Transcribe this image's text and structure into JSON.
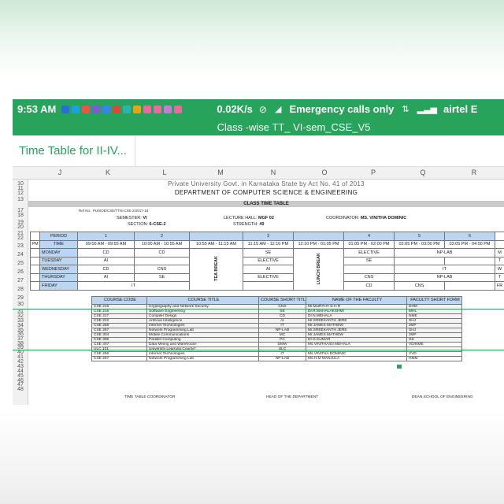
{
  "status_bar": {
    "time": "9:53 AM",
    "net_speed": "0.02K/s",
    "emergency": "Emergency calls only",
    "carrier": "airtel E",
    "notification_icon_colors": [
      "#2a6cd6",
      "#1aa1e0",
      "#e8534a",
      "#7c5bd6",
      "#3a82f0",
      "#d64a3e",
      "#2bb5a6",
      "#e5a31a",
      "#e86aa0",
      "#e86aa0",
      "#c77bd8",
      "#e86aa0"
    ]
  },
  "title_bar": {
    "title": "Class -wise TT_ VI-sem_CSE_V5"
  },
  "sheet_tab": {
    "label": "Time Table for II-IV..."
  },
  "columns": [
    "J",
    "K",
    "L",
    "M",
    "N",
    "O",
    "P",
    "Q",
    "R"
  ],
  "rows": [
    "10",
    "11",
    "12",
    "13",
    "17",
    "18",
    "19",
    "20",
    "21",
    "22",
    "23",
    "24",
    "25",
    "26",
    "27",
    "28",
    "29",
    "30",
    "31",
    "32",
    "33",
    "34",
    "35",
    "36",
    "37",
    "38",
    "39",
    "40",
    "41",
    "42",
    "43",
    "44",
    "45",
    "46",
    "47",
    "48"
  ],
  "header": {
    "tiny_note": "Private University Govt. in Karnataka State by Act No. 41 of 2013",
    "department": "DEPARTMENT  OF  COMPUTER  SCIENCE  &  ENGINEERING",
    "class_time_table": "CLASS TIME TABLE",
    "ref_no": "Ref No.: PU/SOE/CSE/TT/6-CSE-2/2017-18",
    "semester_label": "SEMESTER:",
    "semester": "VI",
    "section_label": "SECTION:",
    "section": "6-CSE-2",
    "hall_label": "LECTURE HALL:",
    "hall": "MGF 02",
    "strength_label": "STRENGTH:",
    "strength": "49",
    "coordinator_label": "COORDINATOR:",
    "coordinator": "MS. VINITHA DOMINIC"
  },
  "timetable": {
    "period_label": "PERIOD",
    "time_label": "TIME",
    "left_cut": [
      "PM"
    ],
    "periods": [
      "1",
      "2",
      "",
      "3",
      "",
      "4",
      "5",
      "6"
    ],
    "times": [
      "09:00 AM - 09:55 AM",
      "10:00 AM - 10:55 AM",
      "10:55 AM - 11:15 AM",
      "11:15 AM - 12:10 PM",
      "12:10 PM - 01:05 PM",
      "01:05 PM - 02:00 PM",
      "02:05 PM - 03:00 PM",
      "03:05 PM - 04:00 PM"
    ],
    "tea_break": "TEA BREAK",
    "lunch_break": "LUNCH BREAK",
    "days": [
      "MONDAY",
      "TUESDAY",
      "WEDNESDAY",
      "THURSDAY",
      "FRIDAY"
    ],
    "right_cut": [
      "M",
      "T",
      "W",
      "T",
      "FR"
    ],
    "monday": {
      "p1": "CD",
      "p2": "CD",
      "p3": "SE",
      "p4": "ELECTIVE",
      "p56": "NP-LAB"
    },
    "tuesday": {
      "p1": "AI",
      "p3": "ELECTIVE",
      "p4": "SE"
    },
    "wednesday": {
      "p1": "CD",
      "p2": "CNS",
      "p3": "AI",
      "p56": "IT"
    },
    "thursday": {
      "p1": "AI",
      "p2": "SE",
      "p3": "ELECTIVE",
      "p4": "CNS",
      "p56": "NP-LAB"
    },
    "friday": {
      "p123": "IT",
      "p4": "CD",
      "p5": "CNS"
    }
  },
  "courses": {
    "headers": [
      "COURSE CODE",
      "COURSE TITLE",
      "COURSE SHORT TITLE",
      "NAME OF THE FACULTY",
      "FACULTY SHORT FORM"
    ],
    "rows": [
      [
        "CSE 215",
        "Cryptography and Network Security",
        "CNS",
        "Mr.MURTHY D H R",
        "DHM"
      ],
      [
        "CSE 216",
        "Software Engineering",
        "SE",
        "Dr.R.MAHALAKSHMI",
        "MHL"
      ],
      [
        "CSE 217",
        "Compiler Design",
        "CD",
        "Dr.N.MEHALA",
        "NME"
      ],
      [
        "CSE 222",
        "Artificial Intelligence",
        "AI",
        "Mr.SREEKANTH JERE",
        "SHJ"
      ],
      [
        "CSE 256",
        "Internet Technologies",
        "IT",
        "Mr.JAMES MATHEW",
        "JMP"
      ],
      [
        "CSE 257",
        "Network Programming Lab",
        "NP-LAB",
        "Mr.SREEKANTH JERE",
        "SHJ"
      ],
      [
        "CSE 304",
        "Mobile Communications",
        "MC",
        "Mr.JAMES MATHEW",
        "JMP"
      ],
      [
        "CSE 305",
        "Parallel Computing",
        "PC",
        "Dr.G.KUMAR",
        "GK"
      ],
      [
        "CSE 307",
        "Data Mining and Warehouse",
        "DMW",
        "Ms.VINITHA/Dr.MEHALA",
        "VD/NME"
      ],
      [
        "ULC 101",
        "University Learning Course*",
        "ULC",
        "",
        ""
      ],
      [
        "CSE 256",
        "Internet Technologies",
        "IT",
        "Ms.VINITHA DOMINIC",
        "VVD"
      ],
      [
        "CSE 257",
        "Network Programming Lab",
        "NP-LAB",
        "Ms.H.M MANJULA",
        "HMM"
      ]
    ]
  },
  "footer": {
    "left": "TIME TABLE COORDINATOR",
    "middle": "HEAD OF THE DEPARTMENT",
    "right": "DEAN,SCHOOL OF ENGINEERING"
  }
}
